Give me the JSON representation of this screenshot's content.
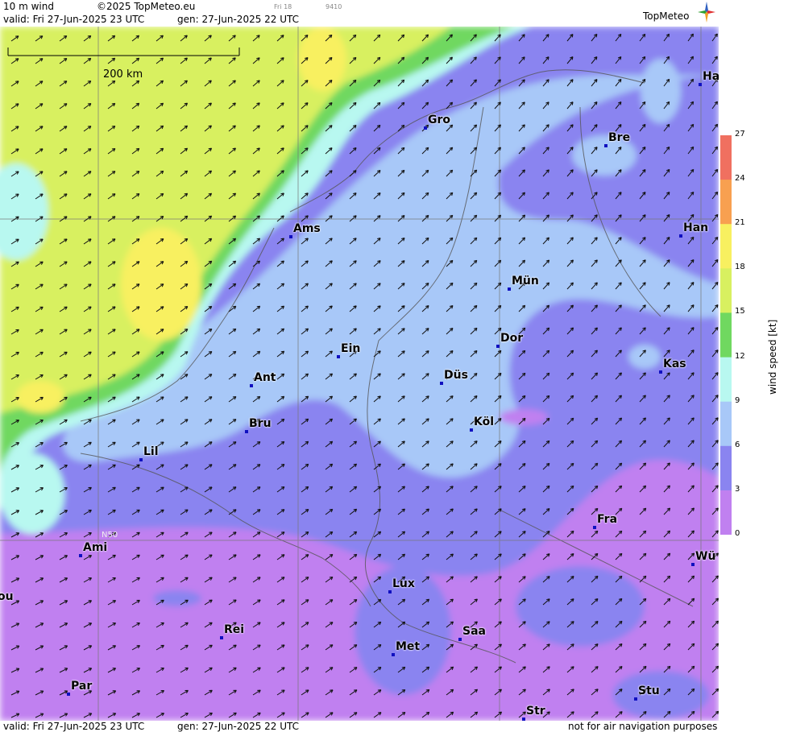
{
  "header": {
    "product": "10 m wind",
    "copyright": "©2025 TopMeteo.eu",
    "valid": "valid:  Fri  27-Jun-2025  23 UTC",
    "gen": "gen: 27-Jun-2025 22 UTC",
    "small1": "Fri 18",
    "small2": "9410",
    "logo": "TopMeteo"
  },
  "scale": {
    "label": "200 km"
  },
  "latitude_label": "N50",
  "cities": [
    {
      "name": "Ha"
    },
    {
      "name": "Gro"
    },
    {
      "name": "Bre"
    },
    {
      "name": "Ams"
    },
    {
      "name": "Han"
    },
    {
      "name": "Mün"
    },
    {
      "name": "Ein"
    },
    {
      "name": "Dor"
    },
    {
      "name": "Ant"
    },
    {
      "name": "Düs"
    },
    {
      "name": "Kas"
    },
    {
      "name": "Bru"
    },
    {
      "name": "Köl"
    },
    {
      "name": "Lil"
    },
    {
      "name": "Fra"
    },
    {
      "name": "Ami"
    },
    {
      "name": "Wü"
    },
    {
      "name": "Lux"
    },
    {
      "name": "ou"
    },
    {
      "name": "Rei"
    },
    {
      "name": "Saa"
    },
    {
      "name": "Met"
    },
    {
      "name": "Stu"
    },
    {
      "name": "Par"
    },
    {
      "name": "Str"
    }
  ],
  "legend": {
    "title": "wind  speed  [kt]",
    "ticks": [
      "27",
      "24",
      "21",
      "18",
      "15",
      "12",
      "9",
      "6",
      "3",
      "0"
    ],
    "colors": [
      "#f07060",
      "#f8a050",
      "#f8f060",
      "#d8f060",
      "#70d860",
      "#b8f8f0",
      "#a8c8f8",
      "#8a84f0",
      "#c080f0"
    ]
  },
  "footer": {
    "valid": "valid:  Fri  27-Jun-2025  23 UTC",
    "gen": "gen: 27-Jun-2025 22 UTC",
    "note": "not for air navigation purposes"
  }
}
